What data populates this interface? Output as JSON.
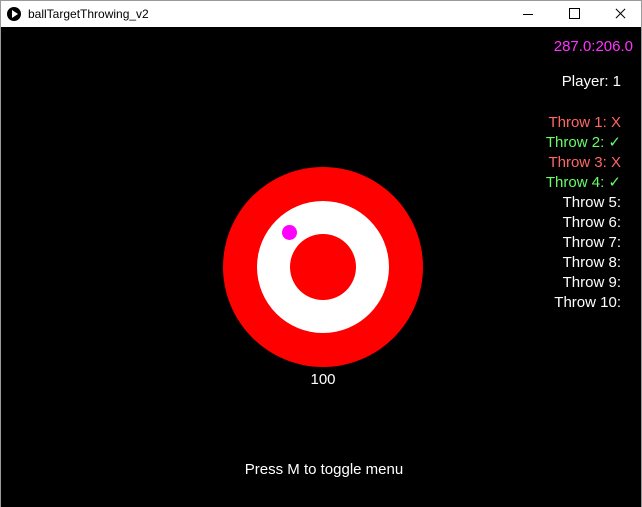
{
  "window": {
    "title": "ballTargetThrowing_v2"
  },
  "hud": {
    "coords": "287.0:206.0",
    "player": "Player: 1",
    "throws": [
      {
        "label": "Throw 1:",
        "result": "X",
        "color": "#ff6666"
      },
      {
        "label": "Throw 2:",
        "result": "✓",
        "color": "#66ff66"
      },
      {
        "label": "Throw 3:",
        "result": "X",
        "color": "#ff6666"
      },
      {
        "label": "Throw 4:",
        "result": "✓",
        "color": "#66ff66"
      },
      {
        "label": "Throw 5:",
        "result": "",
        "color": "#ffffff"
      },
      {
        "label": "Throw 6:",
        "result": "",
        "color": "#ffffff"
      },
      {
        "label": "Throw 7:",
        "result": "",
        "color": "#ffffff"
      },
      {
        "label": "Throw 8:",
        "result": "",
        "color": "#ffffff"
      },
      {
        "label": "Throw 9:",
        "result": "",
        "color": "#ffffff"
      },
      {
        "label": "Throw 10:",
        "result": "",
        "color": "#ffffff"
      }
    ]
  },
  "target": {
    "score": "100",
    "outer_color": "#ff0000",
    "middle_color": "#ffffff",
    "inner_color": "#ff0000",
    "ball_color": "#ff00ff"
  },
  "footer": {
    "hint": "Press M to toggle menu"
  }
}
